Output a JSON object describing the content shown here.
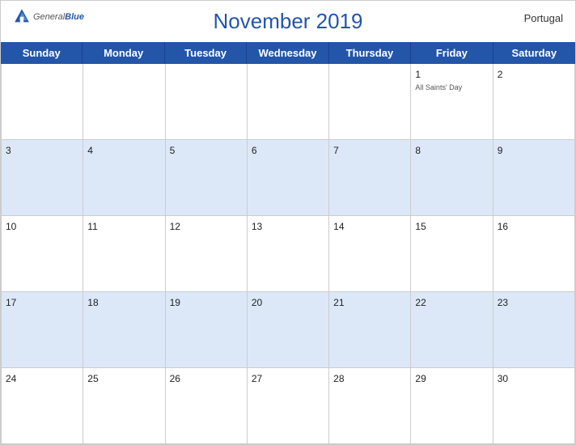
{
  "header": {
    "title": "November 2019",
    "country": "Portugal",
    "logo": {
      "general": "General",
      "blue": "Blue"
    }
  },
  "weekdays": [
    "Sunday",
    "Monday",
    "Tuesday",
    "Wednesday",
    "Thursday",
    "Friday",
    "Saturday"
  ],
  "weeks": [
    [
      {
        "day": "",
        "holiday": ""
      },
      {
        "day": "",
        "holiday": ""
      },
      {
        "day": "",
        "holiday": ""
      },
      {
        "day": "",
        "holiday": ""
      },
      {
        "day": "",
        "holiday": ""
      },
      {
        "day": "1",
        "holiday": "All Saints' Day"
      },
      {
        "day": "2",
        "holiday": ""
      }
    ],
    [
      {
        "day": "3",
        "holiday": ""
      },
      {
        "day": "4",
        "holiday": ""
      },
      {
        "day": "5",
        "holiday": ""
      },
      {
        "day": "6",
        "holiday": ""
      },
      {
        "day": "7",
        "holiday": ""
      },
      {
        "day": "8",
        "holiday": ""
      },
      {
        "day": "9",
        "holiday": ""
      }
    ],
    [
      {
        "day": "10",
        "holiday": ""
      },
      {
        "day": "11",
        "holiday": ""
      },
      {
        "day": "12",
        "holiday": ""
      },
      {
        "day": "13",
        "holiday": ""
      },
      {
        "day": "14",
        "holiday": ""
      },
      {
        "day": "15",
        "holiday": ""
      },
      {
        "day": "16",
        "holiday": ""
      }
    ],
    [
      {
        "day": "17",
        "holiday": ""
      },
      {
        "day": "18",
        "holiday": ""
      },
      {
        "day": "19",
        "holiday": ""
      },
      {
        "day": "20",
        "holiday": ""
      },
      {
        "day": "21",
        "holiday": ""
      },
      {
        "day": "22",
        "holiday": ""
      },
      {
        "day": "23",
        "holiday": ""
      }
    ],
    [
      {
        "day": "24",
        "holiday": ""
      },
      {
        "day": "25",
        "holiday": ""
      },
      {
        "day": "26",
        "holiday": ""
      },
      {
        "day": "27",
        "holiday": ""
      },
      {
        "day": "28",
        "holiday": ""
      },
      {
        "day": "29",
        "holiday": ""
      },
      {
        "day": "30",
        "holiday": ""
      }
    ]
  ],
  "colors": {
    "blue": "#2356a8",
    "lightBlue": "#dce8f8",
    "headerText": "#fff"
  }
}
